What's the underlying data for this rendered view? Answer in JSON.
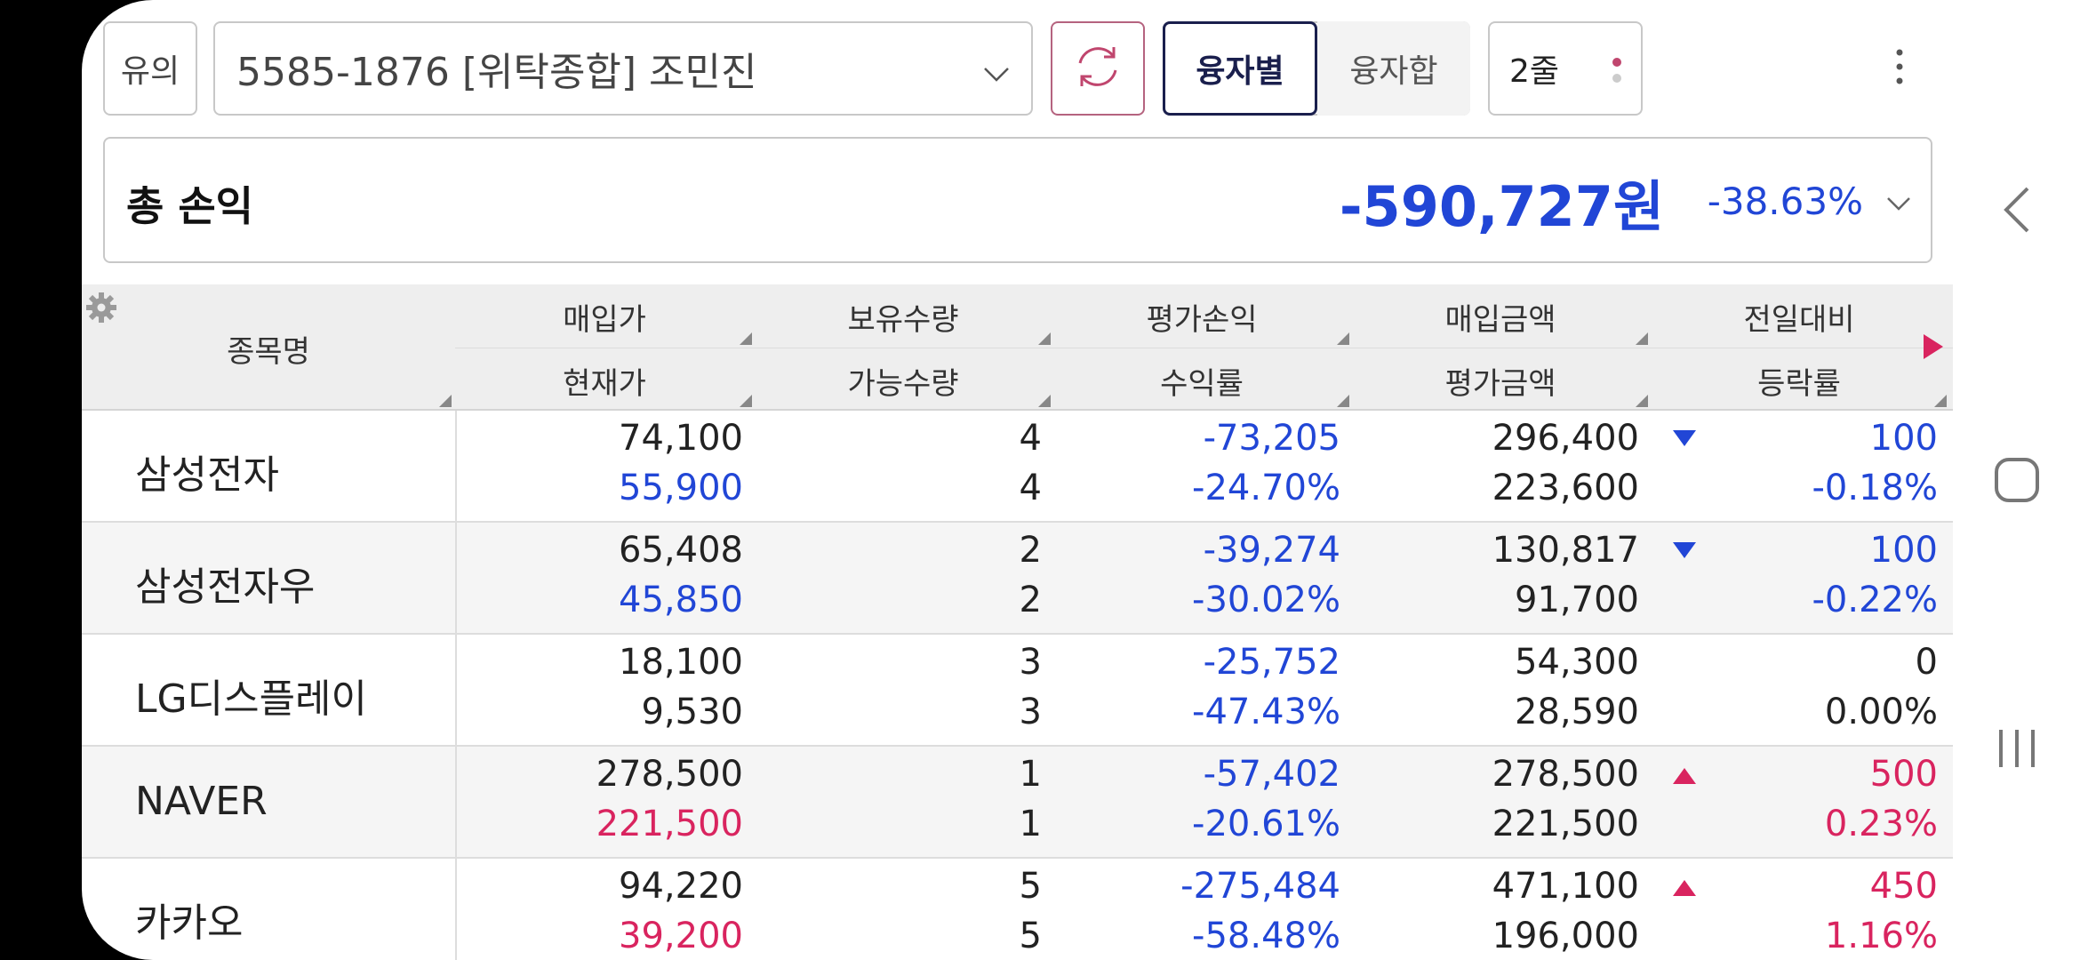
{
  "topbar": {
    "warn_label": "유의",
    "account": "5585-1876 [위탁종합] 조민진",
    "seg_active": "융자별",
    "seg_inactive": "융자합",
    "rows_label": "2줄"
  },
  "total": {
    "label": "총 손익",
    "amount": "-590,727원",
    "rate": "-38.63%"
  },
  "table": {
    "name_header": "종목명",
    "header_top": [
      "매입가",
      "보유수량",
      "평가손익",
      "매입금액",
      "전일대비"
    ],
    "header_bottom": [
      "현재가",
      "가능수량",
      "수익률",
      "평가금액",
      "등락률"
    ],
    "rows": [
      {
        "name": "삼성전자",
        "buy_price": "74,100",
        "cur_price": "55,900",
        "hold_qty": "4",
        "avail_qty": "4",
        "eval_pl": "-73,205",
        "return_rate": "-24.70%",
        "buy_amount": "296,400",
        "eval_amount": "223,600",
        "change": "100",
        "change_rate": "-0.18%",
        "direction": "down"
      },
      {
        "name": "삼성전자우",
        "buy_price": "65,408",
        "cur_price": "45,850",
        "hold_qty": "2",
        "avail_qty": "2",
        "eval_pl": "-39,274",
        "return_rate": "-30.02%",
        "buy_amount": "130,817",
        "eval_amount": "91,700",
        "change": "100",
        "change_rate": "-0.22%",
        "direction": "down"
      },
      {
        "name": "LG디스플레이",
        "buy_price": "18,100",
        "cur_price": "9,530",
        "hold_qty": "3",
        "avail_qty": "3",
        "eval_pl": "-25,752",
        "return_rate": "-47.43%",
        "buy_amount": "54,300",
        "eval_amount": "28,590",
        "change": "0",
        "change_rate": "0.00%",
        "direction": "flat"
      },
      {
        "name": "NAVER",
        "buy_price": "278,500",
        "cur_price": "221,500",
        "hold_qty": "1",
        "avail_qty": "1",
        "eval_pl": "-57,402",
        "return_rate": "-20.61%",
        "buy_amount": "278,500",
        "eval_amount": "221,500",
        "change": "500",
        "change_rate": "0.23%",
        "direction": "up"
      },
      {
        "name": "카카오",
        "buy_price": "94,220",
        "cur_price": "39,200",
        "hold_qty": "5",
        "avail_qty": "5",
        "eval_pl": "-275,484",
        "return_rate": "-58.48%",
        "buy_amount": "471,100",
        "eval_amount": "196,000",
        "change": "450",
        "change_rate": "1.16%",
        "direction": "up"
      }
    ]
  },
  "colors": {
    "negative": "#2146d6",
    "positive": "#d9245f",
    "accent_dark": "#1a1f4d"
  },
  "icons": {
    "account_dropdown": "chevron-down-icon",
    "refresh": "refresh-icon",
    "rows_menu": "dots-icon",
    "more_menu": "kebab-icon",
    "total_toggle": "chevron-down-icon",
    "table_settings": "gear-icon",
    "more_columns": "triangle-right-icon",
    "nav_back": "back-icon",
    "nav_home": "home-icon",
    "nav_recents": "recents-icon"
  }
}
